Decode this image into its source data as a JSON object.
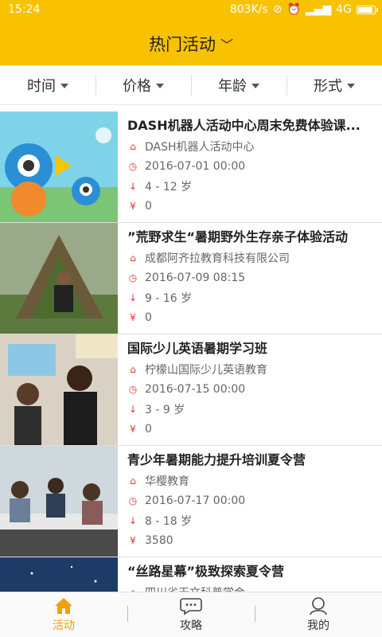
{
  "status": {
    "time": "15:24",
    "speed": "803K/s",
    "network": "4G",
    "battery_level": 0.9
  },
  "header": {
    "title": "热门活动"
  },
  "filters": [
    {
      "label": "时间"
    },
    {
      "label": "价格"
    },
    {
      "label": "年龄"
    },
    {
      "label": "形式"
    }
  ],
  "activities": [
    {
      "title": "DASH机器人活动中心周末免费体验课...",
      "org": "DASH机器人活动中心",
      "date": "2016-07-01 00:00",
      "age": "4 - 12 岁",
      "price": "0"
    },
    {
      "title": "”荒野求生“暑期野外生存亲子体验活动",
      "org": "成都阿齐拉教育科技有限公司",
      "date": "2016-07-09 08:15",
      "age": "9 - 16 岁",
      "price": "0"
    },
    {
      "title": "国际少儿英语暑期学习班",
      "org": "柠檬山国际少儿英语教育",
      "date": "2016-07-15 00:00",
      "age": "3 - 9 岁",
      "price": "0"
    },
    {
      "title": "青少年暑期能力提升培训夏令营",
      "org": "华樱教育",
      "date": "2016-07-17 00:00",
      "age": "8 - 18 岁",
      "price": "3580"
    },
    {
      "title": "“丝路星幕”极致探索夏令营",
      "org": "四川省天文科普学会",
      "date": "",
      "age": "",
      "price": ""
    }
  ],
  "icons": {
    "org": "home-icon",
    "date": "clock-icon",
    "age": "sort-number-icon",
    "price": "yen-icon"
  },
  "currency_symbol": "¥",
  "nav": [
    {
      "label": "活动",
      "icon": "home-icon",
      "active": true
    },
    {
      "label": "攻略",
      "icon": "chat-bubble-icon",
      "active": false
    },
    {
      "label": "我的",
      "icon": "user-icon",
      "active": false
    }
  ],
  "colors": {
    "brand": "#f9c200",
    "accent_icon": "#e33333",
    "active_nav": "#f0a000"
  }
}
